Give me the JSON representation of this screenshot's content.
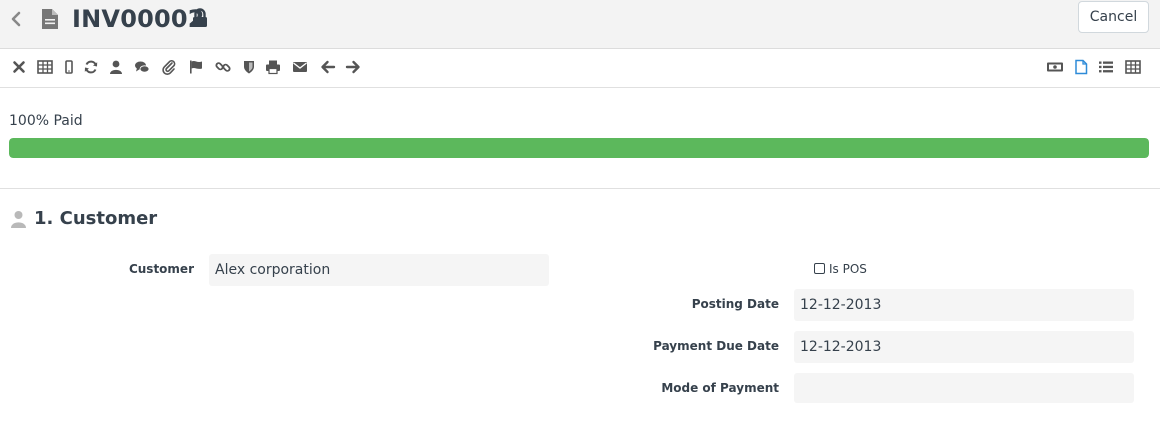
{
  "header": {
    "title": "INV00002",
    "cancel_label": "Cancel",
    "icons": [
      "chevron-left-icon",
      "file-icon",
      "lock-icon"
    ]
  },
  "toolbar": {
    "left_icons": [
      "close-icon",
      "table-icon",
      "mobile-icon",
      "refresh-icon",
      "user-icon",
      "comments-icon",
      "paperclip-icon",
      "flag-icon",
      "link-icon",
      "shield-icon",
      "print-icon",
      "envelope-icon",
      "arrow-left-icon",
      "arrow-right-icon"
    ],
    "right_icons": [
      "money-icon",
      "file-outline-icon",
      "list-icon",
      "grid-icon"
    ],
    "active_right_icon": "file-outline-icon"
  },
  "progress": {
    "label": "100% Paid",
    "percent": 100,
    "color": "#5cb85c"
  },
  "section": {
    "title": "1. Customer",
    "icon": "user-icon"
  },
  "fields": {
    "customer_label": "Customer",
    "customer_value": "Alex corporation",
    "is_pos_label": "Is POS",
    "is_pos_checked": false,
    "posting_date_label": "Posting Date",
    "posting_date_value": "12-12-2013",
    "payment_due_date_label": "Payment Due Date",
    "payment_due_date_value": "12-12-2013",
    "mode_of_payment_label": "Mode of Payment",
    "mode_of_payment_value": ""
  },
  "colors": {
    "text": "#36414c",
    "icon": "#555555",
    "active_icon": "#2e8bd8",
    "field_bg": "#f5f5f5",
    "header_bg": "#f3f3f3"
  }
}
